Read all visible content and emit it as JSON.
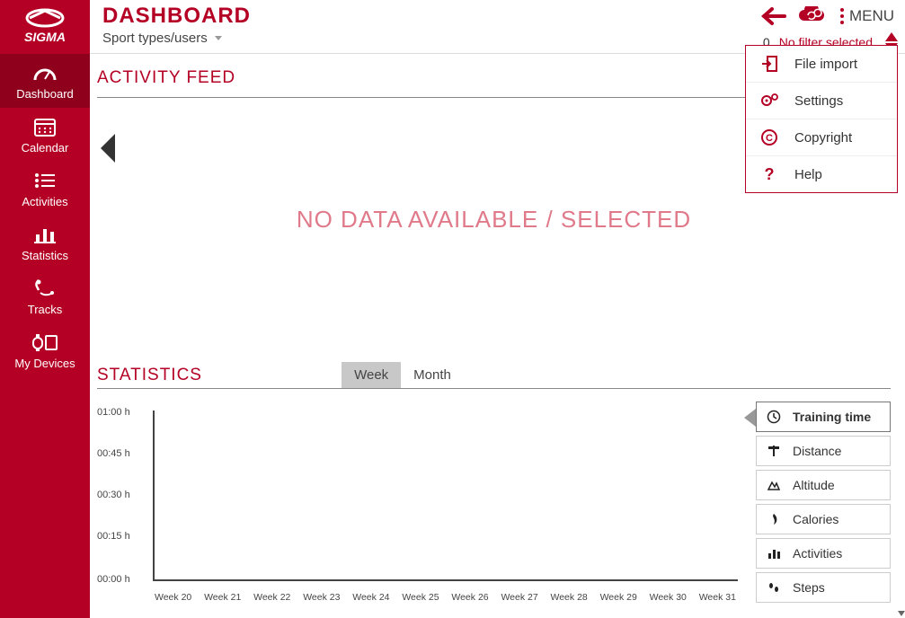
{
  "brand": "SIGMA",
  "sidebar": {
    "items": [
      {
        "label": "Dashboard"
      },
      {
        "label": "Calendar"
      },
      {
        "label": "Activities"
      },
      {
        "label": "Statistics"
      },
      {
        "label": "Tracks"
      },
      {
        "label": "My Devices"
      }
    ]
  },
  "header": {
    "title": "DASHBOARD",
    "subtitle": "Sport types/users",
    "menu_label": "MENU"
  },
  "filter": {
    "count": "0",
    "label": "No filter selected"
  },
  "menu": {
    "items": [
      {
        "label": "File import"
      },
      {
        "label": "Settings"
      },
      {
        "label": "Copyright"
      },
      {
        "label": "Help"
      }
    ]
  },
  "feed": {
    "title": "ACTIVITY FEED",
    "no_data": "NO DATA AVAILABLE / SELECTED"
  },
  "statistics": {
    "title": "STATISTICS",
    "tabs": {
      "week": "Week",
      "month": "Month"
    },
    "metrics": [
      {
        "label": "Training time"
      },
      {
        "label": "Distance"
      },
      {
        "label": "Altitude"
      },
      {
        "label": "Calories"
      },
      {
        "label": "Activities"
      },
      {
        "label": "Steps"
      }
    ]
  },
  "chart_data": {
    "type": "bar",
    "title": "",
    "xlabel": "",
    "ylabel": "",
    "ylim": [
      "00:00 h",
      "01:00 h"
    ],
    "y_ticks": [
      "01:00 h",
      "00:45 h",
      "00:30 h",
      "00:15 h",
      "00:00 h"
    ],
    "categories": [
      "Week 20",
      "Week 21",
      "Week 22",
      "Week 23",
      "Week 24",
      "Week 25",
      "Week 26",
      "Week 27",
      "Week 28",
      "Week 29",
      "Week 30",
      "Week 31"
    ],
    "values": [
      0,
      0,
      0,
      0,
      0,
      0,
      0,
      0,
      0,
      0,
      0,
      0
    ]
  },
  "cloud": {
    "title": "SIGMA CLOUD"
  }
}
